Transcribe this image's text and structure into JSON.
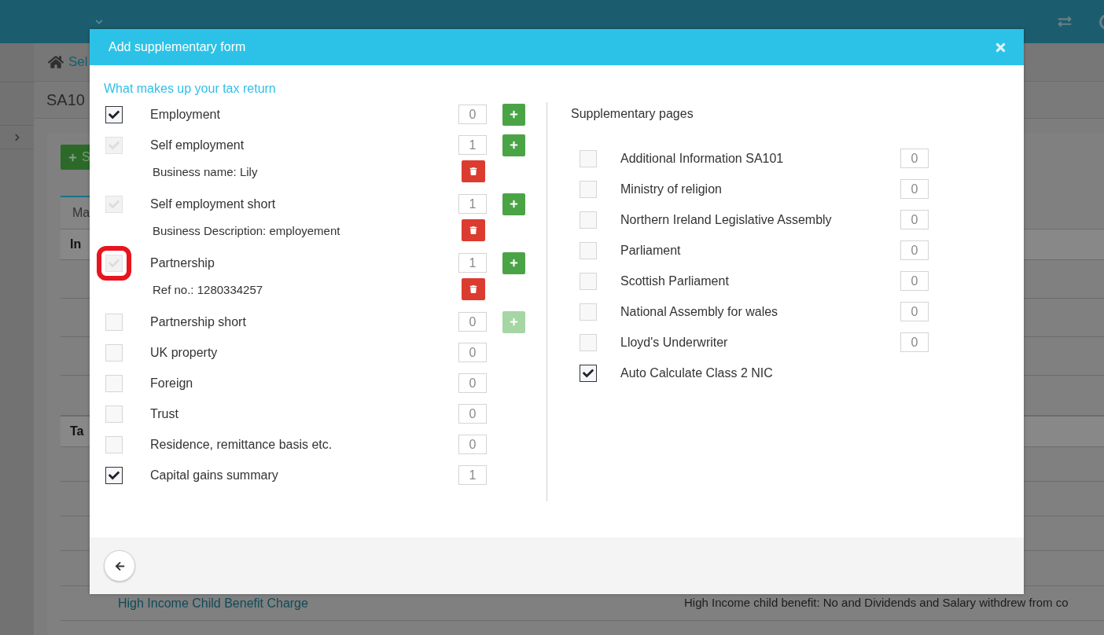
{
  "background": {
    "breadcrumb": "Sel",
    "page_title": "SA10",
    "add_button": "S",
    "tab": "Ma",
    "section_1": "In",
    "section_2": "Ta",
    "rows": [
      {
        "name": "High Income Child Benefit Charge",
        "detail": "High Income child benefit: No and Dividends and Salary withdrew from co"
      }
    ]
  },
  "dialog": {
    "title": "Add supplementary form",
    "section_title": "What makes up your tax return",
    "forms": [
      {
        "label": "Employment",
        "checked": true,
        "disabled": false,
        "highlighted": false,
        "count": "0",
        "add_button": {
          "disabled": false
        }
      },
      {
        "label": "Self employment",
        "checked": true,
        "disabled": true,
        "highlighted": false,
        "count": "1",
        "add_button": {
          "disabled": false
        },
        "details": [
          "Business name: Lily"
        ]
      },
      {
        "label": "Self employment short",
        "checked": true,
        "disabled": true,
        "highlighted": false,
        "count": "1",
        "add_button": {
          "disabled": false
        },
        "details": [
          "Business Description: employement"
        ]
      },
      {
        "label": "Partnership",
        "checked": true,
        "disabled": true,
        "highlighted": true,
        "count": "1",
        "add_button": {
          "disabled": false
        },
        "details": [
          "Ref no.: 1280334257"
        ]
      },
      {
        "label": "Partnership short",
        "checked": false,
        "disabled": false,
        "highlighted": false,
        "count": "0",
        "add_button": {
          "disabled": true
        }
      },
      {
        "label": "UK property",
        "checked": false,
        "disabled": false,
        "highlighted": false,
        "count": "0"
      },
      {
        "label": "Foreign",
        "checked": false,
        "disabled": false,
        "highlighted": false,
        "count": "0"
      },
      {
        "label": "Trust",
        "checked": false,
        "disabled": false,
        "highlighted": false,
        "count": "0"
      },
      {
        "label": "Residence, remittance basis etc.",
        "checked": false,
        "disabled": false,
        "highlighted": false,
        "count": "0"
      },
      {
        "label": "Capital gains summary",
        "checked": true,
        "disabled": false,
        "highlighted": false,
        "count": "1"
      }
    ],
    "supplementary_title": "Supplementary pages",
    "pages": [
      {
        "label": "Additional Information SA101",
        "checked": false,
        "count": "0"
      },
      {
        "label": "Ministry of religion",
        "checked": false,
        "count": "0"
      },
      {
        "label": "Northern Ireland Legislative Assembly",
        "checked": false,
        "count": "0"
      },
      {
        "label": "Parliament",
        "checked": false,
        "count": "0"
      },
      {
        "label": "Scottish Parliament",
        "checked": false,
        "count": "0"
      },
      {
        "label": "National Assembly for wales",
        "checked": false,
        "count": "0"
      },
      {
        "label": "Lloyd's Underwriter",
        "checked": false,
        "count": "0"
      },
      {
        "label": "Auto Calculate Class 2 NIC",
        "checked": true
      }
    ]
  }
}
